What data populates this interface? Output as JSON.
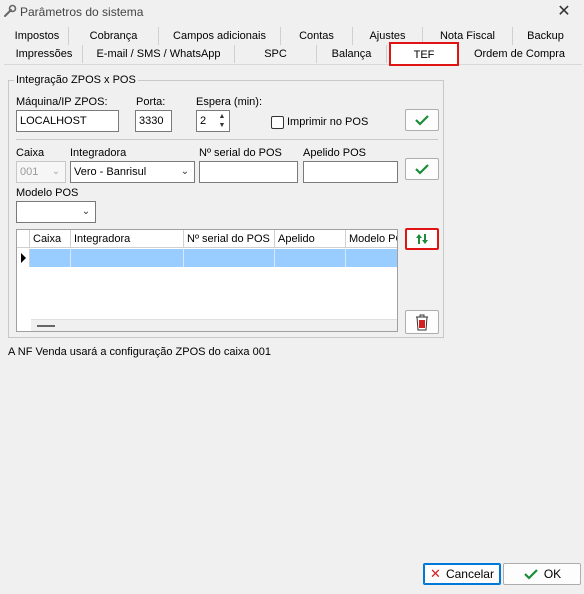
{
  "window": {
    "title": "Parâmetros do sistema",
    "close_icon": "close-icon"
  },
  "tabs_row1": [
    "Impostos",
    "Cobrança",
    "Campos adicionais",
    "Contas",
    "Ajustes",
    "Nota Fiscal",
    "Backup"
  ],
  "tabs_row2": [
    "Impressões",
    "E-mail / SMS / WhatsApp",
    "SPC",
    "Balança",
    "TEF",
    "Ordem de Compra"
  ],
  "active_tab": "TEF",
  "group": {
    "legend": "Integração ZPOS x POS",
    "maquina_label": "Máquina/IP ZPOS:",
    "maquina_value": "LOCALHOST",
    "porta_label": "Porta:",
    "porta_value": "3330",
    "espera_label": "Espera (min):",
    "espera_value": "2",
    "imprimir_label": "Imprimir no POS",
    "caixa_label": "Caixa",
    "caixa_value": "001",
    "integradora_label": "Integradora",
    "integradora_value": "Vero - Banrisul",
    "serial_label": "Nº serial do POS",
    "serial_value": "",
    "apelido_label": "Apelido POS",
    "apelido_value": "",
    "modelo_label": "Modelo POS",
    "modelo_value": ""
  },
  "grid": {
    "columns": [
      "Caixa",
      "Integradora",
      "Nº serial do POS",
      "Apelido",
      "Modelo PC"
    ],
    "rows": [
      [
        "",
        "",
        "",
        "",
        ""
      ]
    ]
  },
  "info_text": "A NF Venda usará a configuração ZPOS do caixa 001",
  "buttons": {
    "cancel": "Cancelar",
    "ok": "OK"
  },
  "colors": {
    "highlight_red": "#e01414",
    "selected_row": "#99ccff",
    "check_green": "#1a8c3a"
  }
}
